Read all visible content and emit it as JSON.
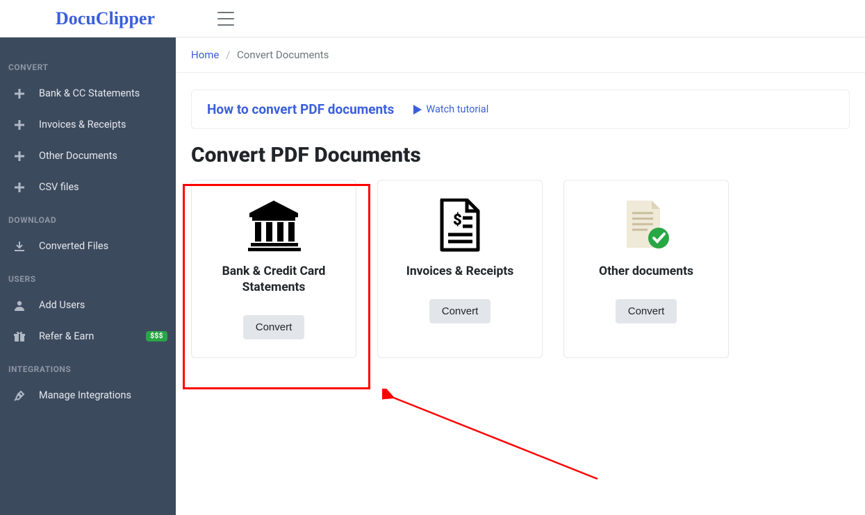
{
  "app": {
    "name": "DocuClipper"
  },
  "breadcrumb": {
    "home": "Home",
    "current": "Convert Documents"
  },
  "sidebar": {
    "sections": [
      {
        "header": "CONVERT",
        "items": [
          {
            "label": "Bank & CC Statements",
            "icon": "plus"
          },
          {
            "label": "Invoices & Receipts",
            "icon": "plus"
          },
          {
            "label": "Other Documents",
            "icon": "plus"
          },
          {
            "label": "CSV files",
            "icon": "plus"
          }
        ]
      },
      {
        "header": "DOWNLOAD",
        "items": [
          {
            "label": "Converted Files",
            "icon": "download"
          }
        ]
      },
      {
        "header": "USERS",
        "items": [
          {
            "label": "Add Users",
            "icon": "user"
          },
          {
            "label": "Refer & Earn",
            "icon": "gift",
            "badge": "$$$"
          }
        ]
      },
      {
        "header": "INTEGRATIONS",
        "items": [
          {
            "label": "Manage Integrations",
            "icon": "plug"
          }
        ]
      }
    ]
  },
  "banner": {
    "title": "How to convert PDF documents",
    "watch": "Watch tutorial"
  },
  "page": {
    "title": "Convert PDF Documents"
  },
  "cards": [
    {
      "title": "Bank & Credit Card Statements",
      "button": "Convert"
    },
    {
      "title": "Invoices & Receipts",
      "button": "Convert"
    },
    {
      "title": "Other documents",
      "button": "Convert"
    }
  ],
  "badges": {
    "money": "$$$"
  }
}
